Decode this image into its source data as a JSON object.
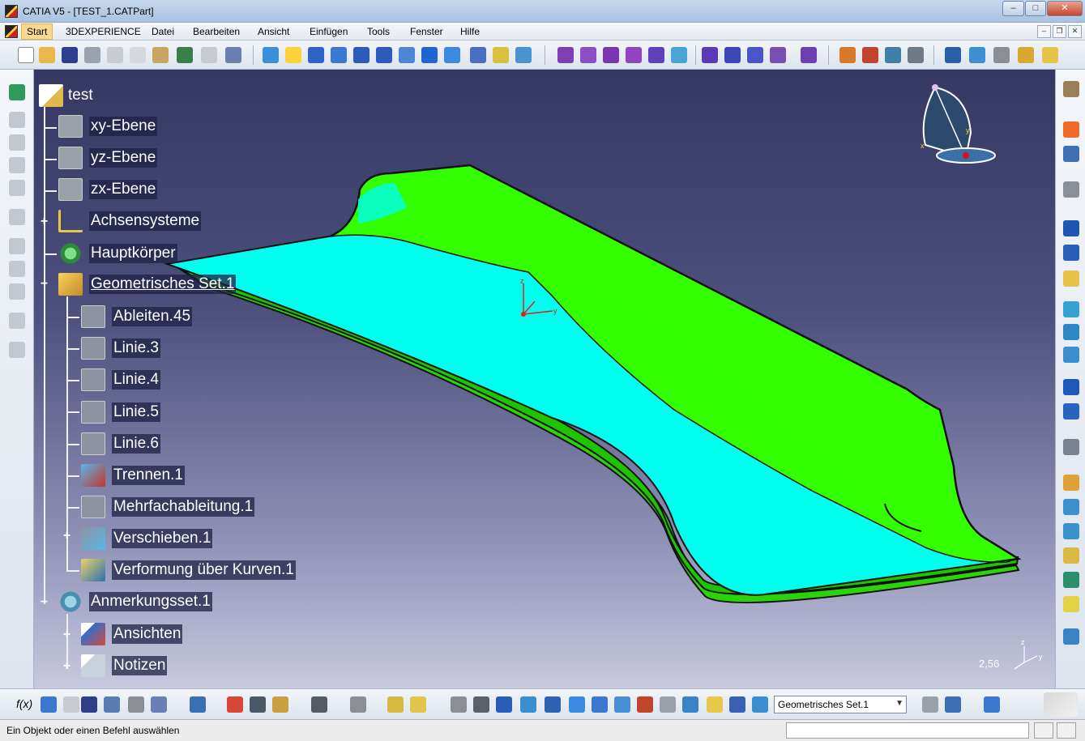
{
  "window": {
    "title": "CATIA V5 - [TEST_1.CATPart]",
    "min": "–",
    "max": "□",
    "close": "✕"
  },
  "menu": {
    "items": [
      "Start",
      "3DEXPERIENCE",
      "Datei",
      "Bearbeiten",
      "Ansicht",
      "Einfügen",
      "Tools",
      "Fenster",
      "Hilfe"
    ],
    "mdi": {
      "min": "–",
      "restore": "❐",
      "close": "✕"
    }
  },
  "tree": {
    "root": "test",
    "nodes": {
      "xy": "xy-Ebene",
      "yz": "yz-Ebene",
      "zx": "zx-Ebene",
      "axis": "Achsensysteme",
      "body": "Hauptkörper",
      "geoset": "Geometrisches Set.1",
      "ableiten": "Ableiten.45",
      "linie3": "Linie.3",
      "linie4": "Linie.4",
      "linie5": "Linie.5",
      "linie6": "Linie.6",
      "trennen": "Trennen.1",
      "mehrfach": "Mehrfachableitung.1",
      "verschieben": "Verschieben.1",
      "verformung": "Verformung über Kurven.1",
      "anmerkung": "Anmerkungsset.1",
      "ansichten": "Ansichten",
      "notizen": "Notizen"
    }
  },
  "viewport": {
    "zoom": "2,56",
    "axis_labels": {
      "x": "x",
      "y": "y",
      "z": "z"
    }
  },
  "bottom_toolbar": {
    "fx": "f(x)",
    "current_set": "Geometrisches Set.1"
  },
  "status": {
    "message": "Ein Objekt oder einen Befehl auswählen",
    "command_value": ""
  },
  "colors": {
    "surface_green": "#33ff00",
    "surface_cyan": "#00ffee",
    "background_top": "#353862",
    "background_bottom": "#c8c9de"
  }
}
